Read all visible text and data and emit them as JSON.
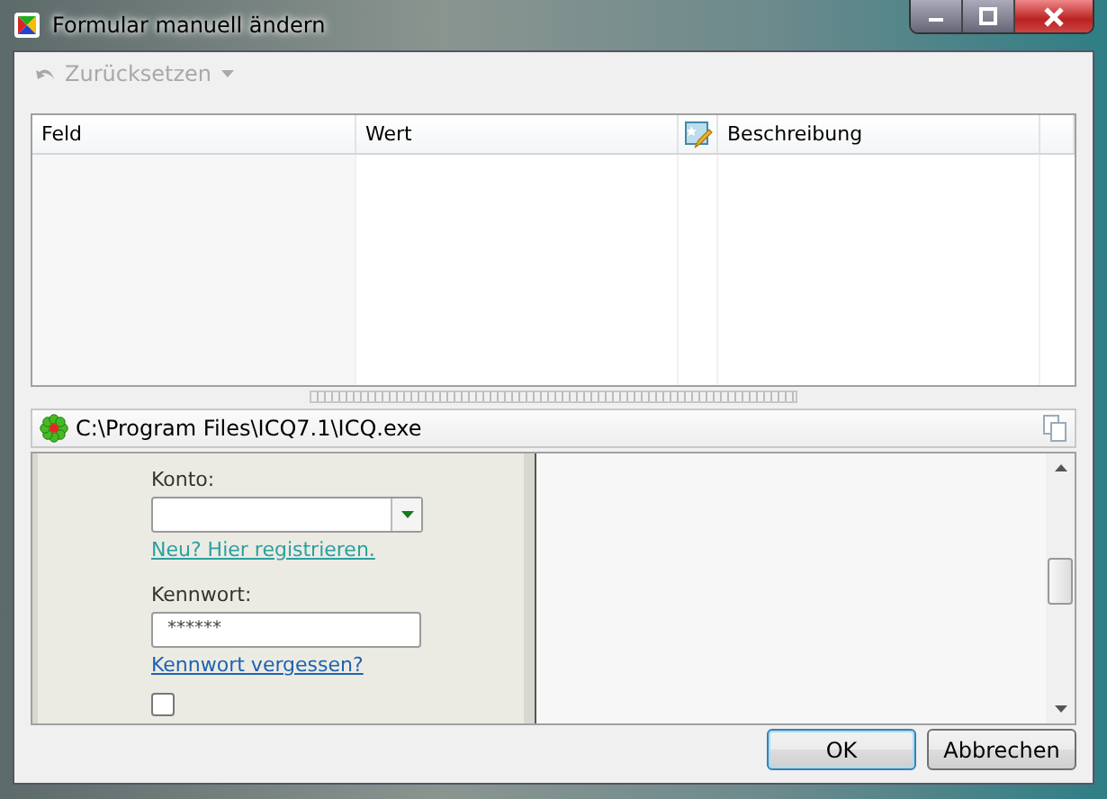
{
  "window": {
    "title": "Formular manuell ändern"
  },
  "toolbar": {
    "reset_button": {
      "label": "Zurücksetzen",
      "disabled": true
    }
  },
  "table": {
    "columns": [
      {
        "label": "Feld"
      },
      {
        "label": "Wert"
      },
      {
        "kind": "icon"
      },
      {
        "label": "Beschreibung"
      },
      {
        "kind": "empty"
      }
    ]
  },
  "path_bar": {
    "path": "C:\\Program Files\\ICQ7.1\\ICQ.exe"
  },
  "form_preview": {
    "account_label": "Konto:",
    "register_link": "Neu? Hier registrieren.",
    "password_label": "Kennwort:",
    "password_value": "******",
    "forgot_link": "Kennwort vergessen?",
    "auto_login": {
      "checked": false
    }
  },
  "buttons": [
    {
      "label": "OK",
      "selected": true
    },
    {
      "label": "Abbrechen",
      "selected": false
    }
  ]
}
